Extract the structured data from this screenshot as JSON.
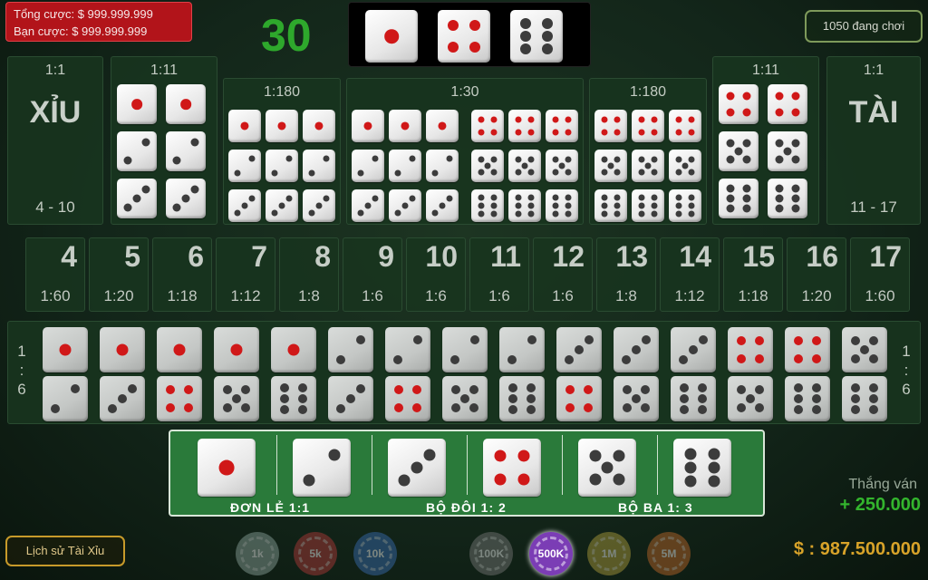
{
  "header": {
    "total_bet_label": "Tổng cược: $ 999.999.999",
    "your_bet_label": "Bạn cược: $ 999.999.999",
    "countdown": "30",
    "players_online": "1050 đang chơi",
    "shaker_dice": [
      1,
      4,
      6
    ]
  },
  "xiu": {
    "odds": "1:1",
    "label": "XỈU",
    "range": "4 - 10"
  },
  "tai": {
    "odds": "1:1",
    "label": "TÀI",
    "range": "11 - 17"
  },
  "doubles_left": {
    "odds": "1:11"
  },
  "doubles_right": {
    "odds": "1:11"
  },
  "triples_left": {
    "odds": "1:180"
  },
  "any_triple": {
    "odds": "1:30"
  },
  "triples_right": {
    "odds": "1:180"
  },
  "sums": [
    {
      "total": "4",
      "odds": "1:60"
    },
    {
      "total": "5",
      "odds": "1:20"
    },
    {
      "total": "6",
      "odds": "1:18"
    },
    {
      "total": "7",
      "odds": "1:12"
    },
    {
      "total": "8",
      "odds": "1:8"
    },
    {
      "total": "9",
      "odds": "1:6"
    },
    {
      "total": "10",
      "odds": "1:6"
    },
    {
      "total": "11",
      "odds": "1:6"
    },
    {
      "total": "12",
      "odds": "1:6"
    },
    {
      "total": "13",
      "odds": "1:8"
    },
    {
      "total": "14",
      "odds": "1:12"
    },
    {
      "total": "15",
      "odds": "1:18"
    },
    {
      "total": "16",
      "odds": "1:20"
    },
    {
      "total": "17",
      "odds": "1:60"
    }
  ],
  "pairs": {
    "odds_left": [
      "1",
      ":",
      "6"
    ],
    "odds_right": [
      "1",
      ":",
      "6"
    ],
    "top": [
      1,
      1,
      1,
      1,
      1,
      2,
      2,
      2,
      2,
      3,
      3,
      3,
      4,
      4,
      5
    ],
    "bottom": [
      2,
      3,
      4,
      5,
      6,
      3,
      4,
      5,
      6,
      4,
      5,
      6,
      5,
      6,
      6
    ]
  },
  "bonus": {
    "dice": [
      1,
      2,
      3,
      4,
      5,
      6
    ],
    "single_label": "ĐƠN LẺ 1:1",
    "double_label": "BỘ ĐÔI 1: 2",
    "triple_label": "BỘ BA 1: 3"
  },
  "win": {
    "label": "Thắng ván",
    "value": "+ 250.000"
  },
  "history_button": "Lịch sử Tài Xỉu",
  "balance": "$ : 987.500.000",
  "chips": [
    {
      "label": "1k",
      "color": "#8fa7a0"
    },
    {
      "label": "5k",
      "color": "#b73a3a"
    },
    {
      "label": "10k",
      "color": "#3a6fb7"
    },
    {
      "label": "100K",
      "color": "#7a7a7a"
    },
    {
      "label": "500K",
      "color": "#7b3db5",
      "selected": true
    },
    {
      "label": "1M",
      "color": "#b5a23d"
    },
    {
      "label": "5M",
      "color": "#c46a2a"
    }
  ]
}
